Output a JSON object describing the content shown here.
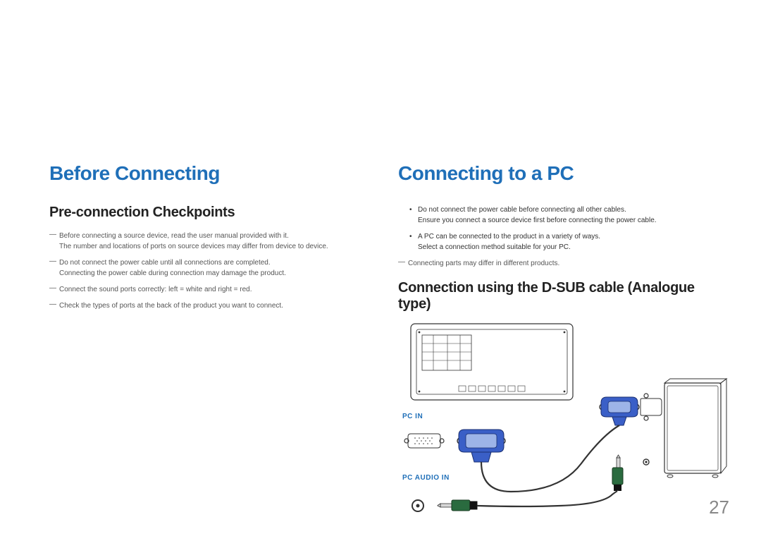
{
  "left": {
    "heading": "Before Connecting",
    "subheading": "Pre-connection Checkpoints",
    "notes": [
      "Before connecting a source device, read the user manual provided with it.\nThe number and locations of ports on source devices may differ from device to device.",
      "Do not connect the power cable until all connections are completed.\nConnecting the power cable during connection may damage the product.",
      "Connect the sound ports correctly: left = white and right = red.",
      "Check the types of ports at the back of the product you want to connect."
    ]
  },
  "right": {
    "heading": "Connecting to a PC",
    "bullets": [
      "Do not connect the power cable before connecting all other cables.\nEnsure you connect a source device first before connecting the power cable.",
      "A PC can be connected to the product in a variety of ways.\nSelect a connection method suitable for your PC."
    ],
    "note": "Connecting parts may differ in different products.",
    "subheading": "Connection using the D-SUB cable (Analogue type)",
    "labels": {
      "pc_in": "PC IN",
      "pc_audio_in": "PC AUDIO IN"
    }
  },
  "page_number": "27"
}
